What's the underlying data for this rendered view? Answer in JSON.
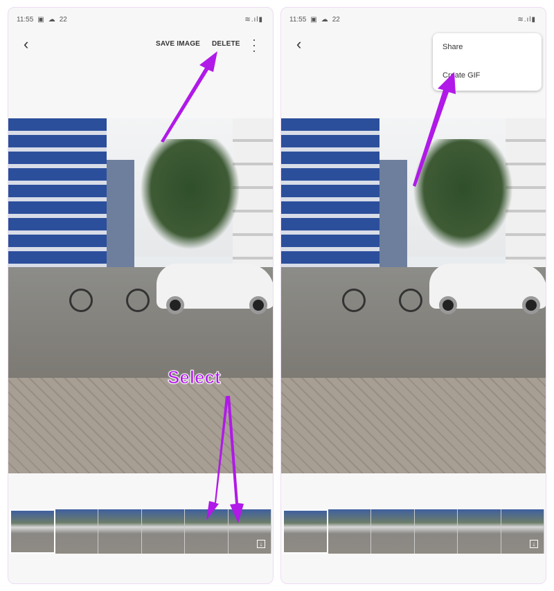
{
  "status": {
    "time": "11:55",
    "notif": "22",
    "icons": [
      "image-icon",
      "cloud-icon",
      "wifi-icon",
      "signal-icon",
      "battery-icon"
    ]
  },
  "left": {
    "save_label": "SAVE IMAGE",
    "delete_label": "DELETE"
  },
  "right": {
    "menu": [
      {
        "label": "Share"
      },
      {
        "label": "Create GIF"
      }
    ]
  },
  "annotation": {
    "select_label": "Select",
    "color": "#b019e8"
  },
  "thumbnails": 6
}
